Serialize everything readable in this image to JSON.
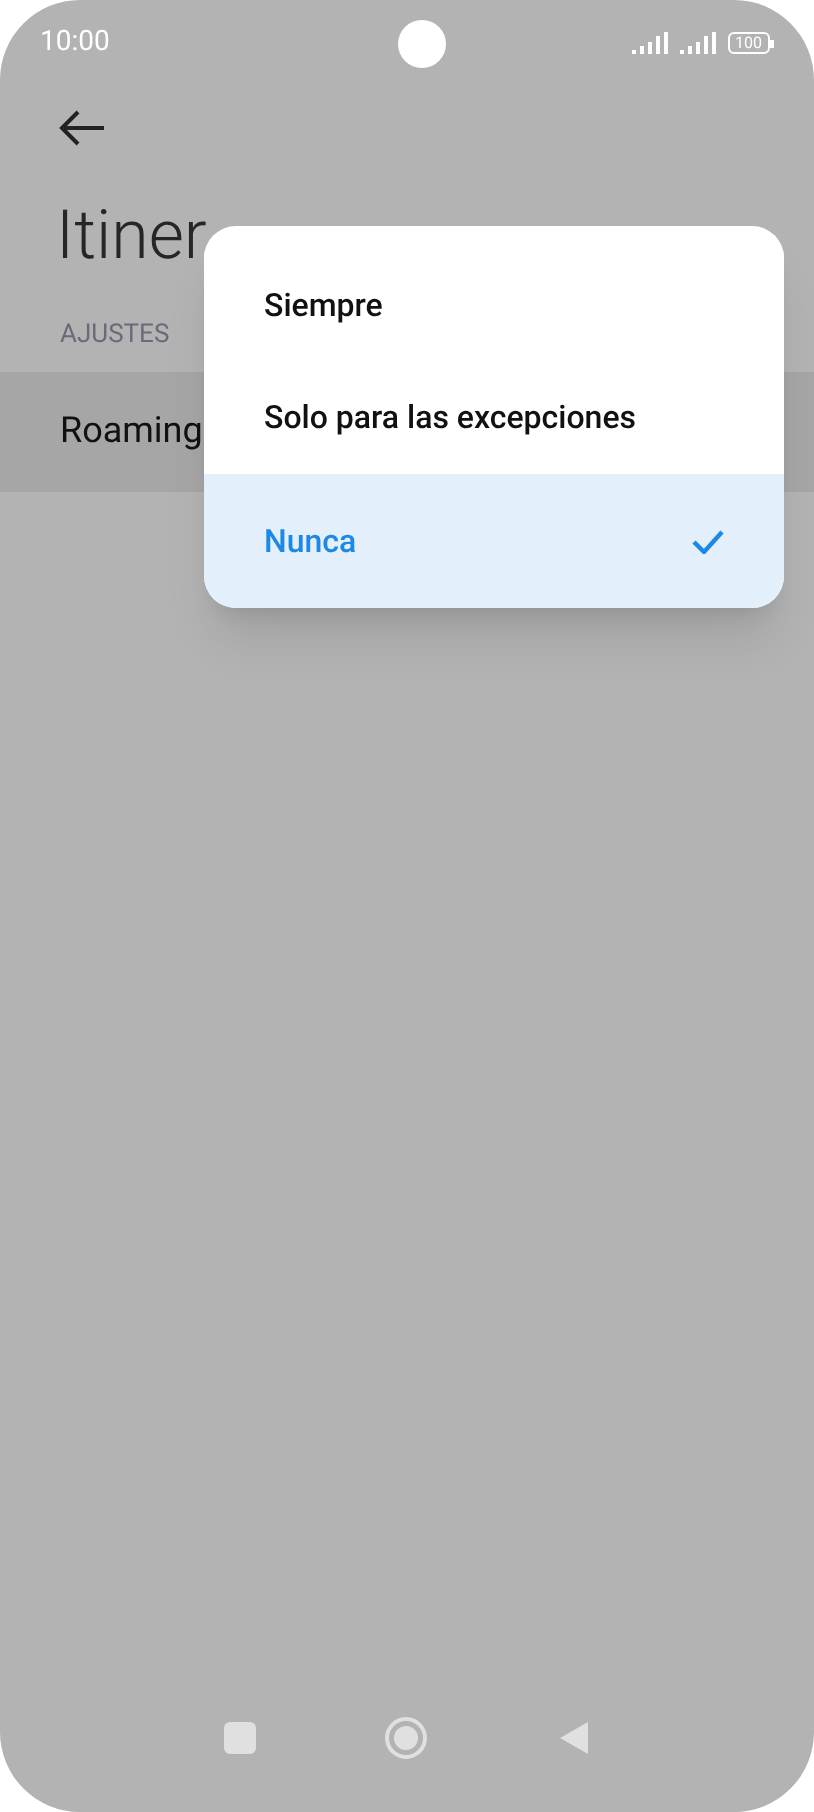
{
  "status_bar": {
    "time": "10:00",
    "battery": "100"
  },
  "page": {
    "title": "Itiner",
    "section": "AJUSTES",
    "row": "Roaming"
  },
  "menu": {
    "options": [
      {
        "label": "Siempre",
        "selected": false
      },
      {
        "label": "Solo para las excepciones",
        "selected": false
      },
      {
        "label": "Nunca",
        "selected": true
      }
    ]
  }
}
